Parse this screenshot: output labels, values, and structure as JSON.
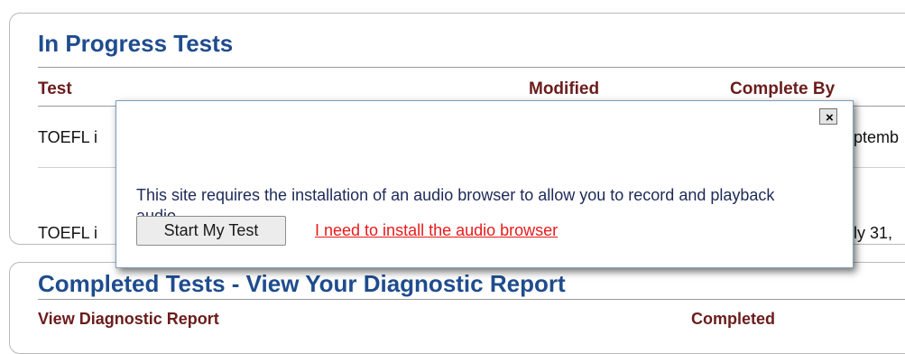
{
  "in_progress": {
    "title": "In Progress Tests",
    "columns": {
      "test": "Test",
      "modified": "Modified",
      "complete_by": "Complete By"
    },
    "rows": [
      {
        "test_visible": "TOEFL i",
        "complete_by_visible": "ptemb"
      },
      {
        "test_visible": "TOEFL i",
        "complete_by_visible": "ly 31,"
      }
    ]
  },
  "completed": {
    "title": "Completed Tests - View Your Diagnostic Report",
    "columns": {
      "report": "View Diagnostic Report",
      "completed": "Completed"
    }
  },
  "modal": {
    "close_label": "×",
    "message": "This site requires the installation of an audio browser to allow you to record and playback audio.",
    "start_button": "Start My Test",
    "install_link": "I need to install the audio browser"
  },
  "colors": {
    "title_blue": "#1f4c8e",
    "header_maroon": "#6b1c1c",
    "link_red": "#e81b1b",
    "message_navy": "#1d2a57"
  }
}
